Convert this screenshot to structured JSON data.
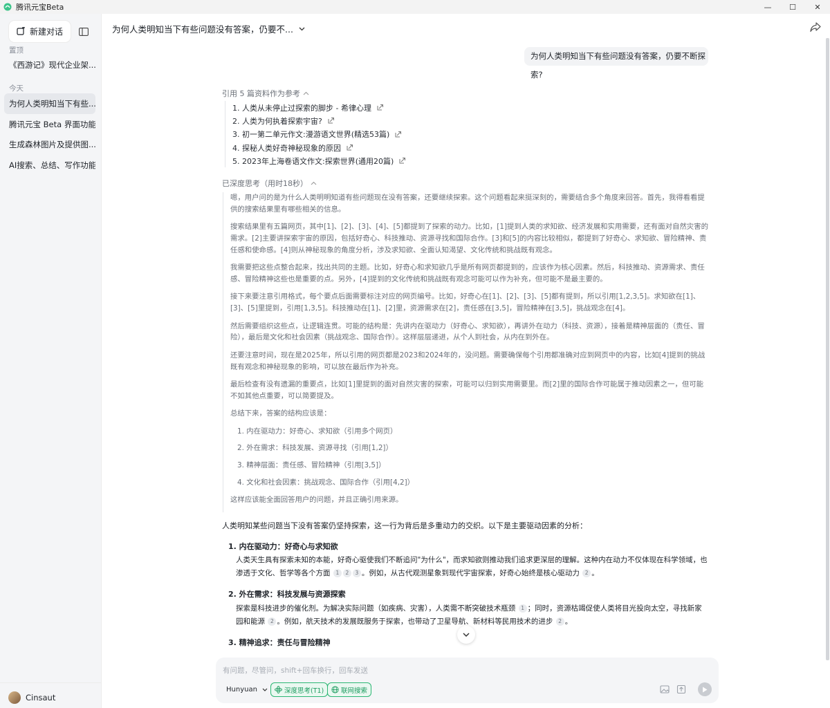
{
  "window": {
    "title": "腾讯元宝Beta",
    "controls": {
      "minimize": "—",
      "maximize": "☐",
      "close": "✕"
    }
  },
  "sidebar": {
    "new_chat_label": "新建对话",
    "pinned_label": "置顶",
    "pinned_items": [
      {
        "label": "《西游记》现代企业架..."
      }
    ],
    "today_label": "今天",
    "today_items": [
      {
        "label": "为何人类明知当下有些..."
      },
      {
        "label": "腾讯元宝 Beta 界面功能..."
      },
      {
        "label": "生成森林图片及提供图..."
      },
      {
        "label": "AI搜索、总结、写作功能..."
      }
    ],
    "user_name": "Cinsaut"
  },
  "header": {
    "title": "为何人类明知当下有些问题没有答案，仍要不..."
  },
  "conversation": {
    "user_message": "为何人类明知当下有些问题没有答案，仍要不断探索?",
    "references": {
      "header": "引用 5 篇资料作为参考",
      "items": [
        {
          "label": "1. 人类从未停止过探索的脚步 - 希律心理"
        },
        {
          "label": "2. 人类为何执着探索宇宙?"
        },
        {
          "label": "3. 初一第二单元作文:漫游语文世界(精选53篇)"
        },
        {
          "label": "4. 探秘人类好奇神秘现象的原因"
        },
        {
          "label": "5. 2023年上海卷语文作文:探索世界(通用20篇)"
        }
      ]
    },
    "thinking": {
      "header": "已深度思考（用时18秒）",
      "paragraphs": [
        "嗯，用户问的是为什么人类明明知道有些问题现在没有答案，还要继续探索。这个问题看起来挺深刻的，需要结合多个角度来回答。首先，我得看看提供的搜索结果里有哪些相关的信息。",
        "搜索结果里有五篇网页，其中[1]、[2]、[3]、[4]、[5]都提到了探索的动力。比如，[1]提到人类的求知欲、经济发展和实用需要，还有面对自然灾害的需求。[2]主要讲探索宇宙的原因，包括好奇心、科技推动、资源寻找和国际合作。[3]和[5]的内容比较相似，都提到了好奇心、求知欲、冒险精神、责任感和使命感。[4]则从神秘现象的角度分析，涉及求知欲、全面认知渴望、文化传统和挑战既有观念。",
        "我需要把这些点整合起来，找出共同的主题。比如，好奇心和求知欲几乎是所有网页都提到的，应该作为核心因素。然后，科技推动、资源需求、责任感、冒险精神这些也是重要的点。另外，[4]提到的文化传统和挑战既有观念可能可以作为补充，但可能不是最主要的。",
        "接下来要注意引用格式，每个要点后面需要标注对应的网页编号。比如，好奇心在[1]、[2]、[3]、[5]都有提到，所以引用[1,2,3,5]。求知欲在[1]、[3]、[5]里提到，引用[1,3,5]。科技推动在[1]、[2]里，资源需求在[2]，责任感在[3,5]，冒险精神在[3,5]，挑战观念在[4]。",
        "然后需要组织这些点，让逻辑连贯。可能的结构是：先讲内在驱动力（好奇心、求知欲），再讲外在动力（科技、资源），接着是精神层面的（责任、冒险），最后是文化和社会因素（挑战观念、国际合作）。这样层层递进，从个人到社会，从内在到外在。",
        "还要注意时间，现在是2025年，所以引用的网页都是2023和2024年的，没问题。需要确保每个引用都准确对应到网页中的内容，比如[4]提到的挑战既有观念和神秘现象的影响，可以放在最后作为补充。",
        "最后检查有没有遗漏的重要点，比如[1]里提到的面对自然灾害的探索，可能可以归到实用需要里。而[2]里的国际合作可能属于推动因素之一，但可能不如其他点重要，可以简要提及。",
        "总结下来，答案的结构应该是："
      ],
      "outline": [
        "1. 内在驱动力：好奇心、求知欲（引用多个网页）",
        "2. 外在需求：科技发展、资源寻找（引用[1,2]）",
        "3. 精神层面：责任感、冒险精神（引用[3,5]）",
        "4. 文化和社会因素：挑战观念、国际合作（引用[4,2]）"
      ],
      "closing": "这样应该能全面回答用户的问题，并且正确引用来源。"
    },
    "answer": {
      "lead": "人类明知某些问题当下没有答案仍坚持探索，这一行为背后是多重动力的交织。以下是主要驱动因素的分析：",
      "sections": [
        {
          "title": "1. 内在驱动力：好奇心与求知欲",
          "body_a": "人类天生具有探索未知的本能，好奇心驱使我们不断追问\"为什么\"，而求知欲则推动我们追求更深层的理解。这种内在动力不仅体现在科学领域，也渗透于文化、哲学等各个方面",
          "cites_a": [
            "1",
            "2",
            "3"
          ],
          "body_b": "。例如，从古代观测星象到现代宇宙探索，好奇心始终是核心驱动力",
          "cites_b": [
            "2"
          ],
          "body_c": "。"
        },
        {
          "title": "2. 外在需求：科技发展与资源探索",
          "body_a": "探索是科技进步的催化剂。为解决实际问题（如疾病、灾害），人类需不断突破技术瓶颈",
          "cites_a": [
            "1"
          ],
          "body_b": "；同时，资源枯竭促使人类将目光投向太空，寻找新家园和能源",
          "cites_b": [
            "2"
          ],
          "body_c": "。例如，航天技术的发展既服务于探索，也带动了卫星导航、新材料等民用技术的进步",
          "cites_c": [
            "2"
          ],
          "body_d": "。"
        },
        {
          "title": "3. 精神追求：责任与冒险精神"
        }
      ]
    }
  },
  "input": {
    "placeholder": "有问题，尽管问，shift+回车换行，回车发送",
    "model": "Hunyuan",
    "deep_think_label": "深度思考(T1)",
    "web_search_label": "联网搜索"
  },
  "colors": {
    "accent_green": "#1f9d61",
    "sidebar_bg": "#f4f5f7",
    "active_item_bg": "#e6e8ec"
  }
}
